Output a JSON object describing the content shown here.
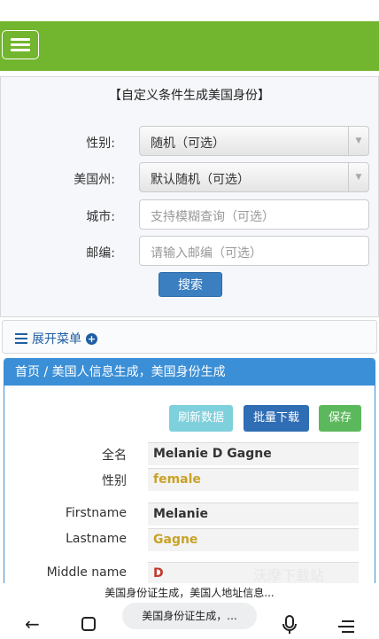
{
  "nav": {
    "menu_icon": "hamburger-menu-icon",
    "brand_color": "#72b52e"
  },
  "form": {
    "title": "【自定义条件生成美国身份】",
    "gender_label": "性别:",
    "gender_value": "随机（可选）",
    "state_label": "美国州:",
    "state_value": "默认随机（可选）",
    "city_label": "城市:",
    "city_placeholder": "支持模糊查询（可选）",
    "zip_label": "邮编:",
    "zip_placeholder": "请输入邮编（可选）",
    "search_label": "搜索"
  },
  "expand_menu": {
    "label": "展开菜单"
  },
  "card": {
    "breadcrumb": "首页 / 美国人信息生成，美国身份生成",
    "buttons": {
      "refresh": "刷新数据",
      "batch": "批量下载",
      "save": "保存"
    },
    "fields": [
      {
        "key": "全名",
        "value": "Melanie D Gagne"
      },
      {
        "key": "性别",
        "value": "female"
      },
      {
        "key": "Firstname",
        "value": "Melanie"
      },
      {
        "key": "Lastname",
        "value": "Gagne"
      },
      {
        "key": "Middle name",
        "value": "D"
      }
    ]
  },
  "watermark": "沃摩下载站",
  "browser": {
    "page_title": "美国身份证生成，美国人地址信息...",
    "url_pill": "美国身份证生成，..."
  }
}
